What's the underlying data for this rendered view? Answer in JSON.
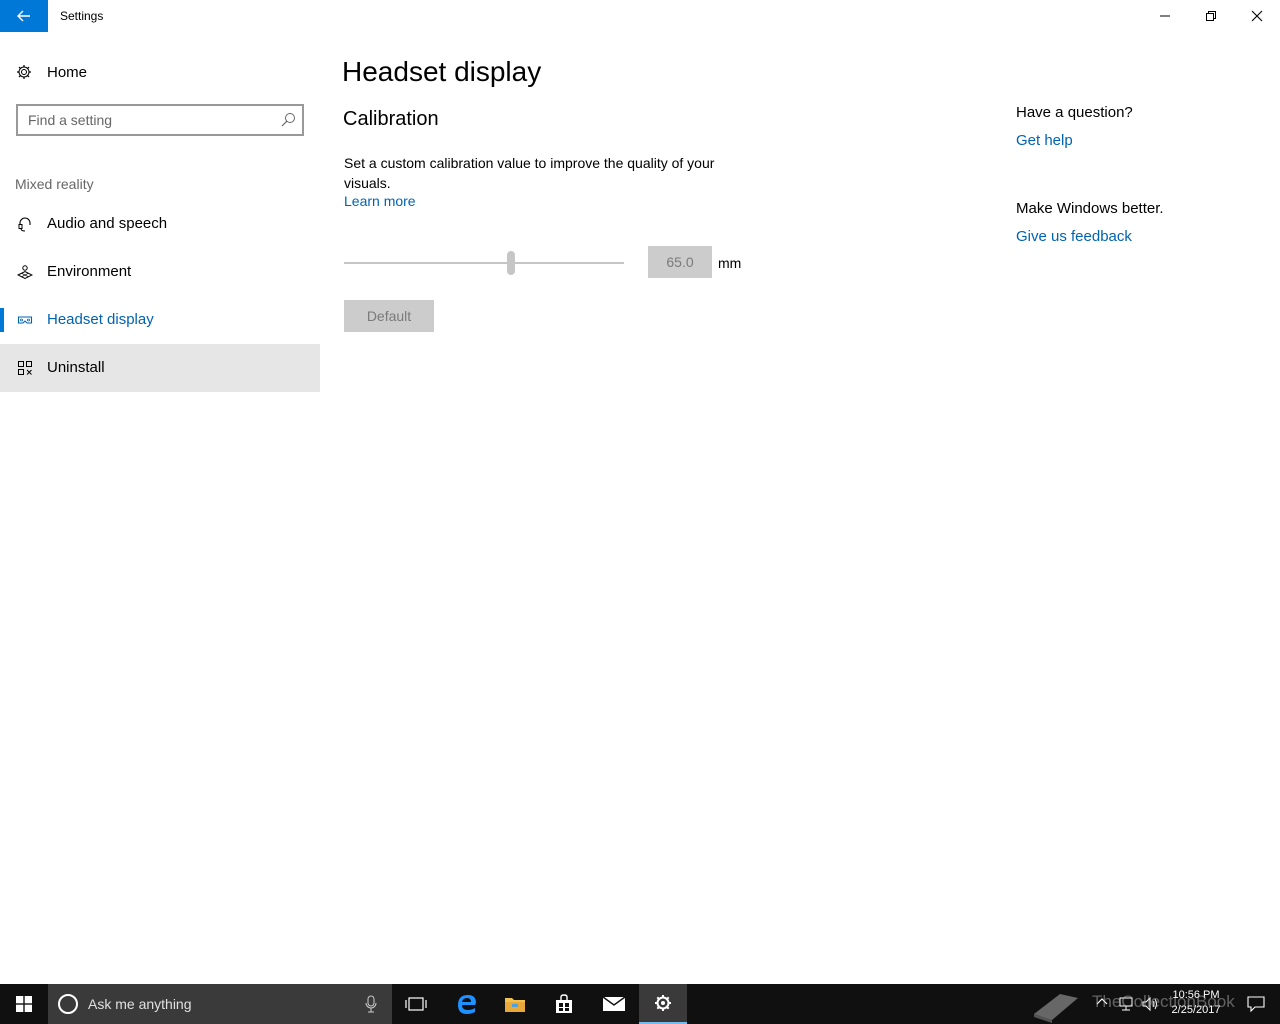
{
  "titlebar": {
    "title": "Settings"
  },
  "sidebar": {
    "home_label": "Home",
    "search_placeholder": "Find a setting",
    "group_label": "Mixed reality",
    "items": [
      {
        "label": "Audio and speech",
        "icon": "headset-icon"
      },
      {
        "label": "Environment",
        "icon": "environment-icon"
      },
      {
        "label": "Headset display",
        "icon": "headset-display-icon",
        "active": true
      },
      {
        "label": "Uninstall",
        "icon": "uninstall-icon",
        "hover": true
      }
    ]
  },
  "main": {
    "page_title": "Headset display",
    "section_title": "Calibration",
    "description": "Set a custom calibration value to improve the quality of your visuals.",
    "learn_more": "Learn more",
    "slider_fraction": 0.6,
    "value": "65.0",
    "unit": "mm",
    "default_button": "Default"
  },
  "help": {
    "question": "Have a question?",
    "get_help": "Get help",
    "better": "Make Windows better.",
    "feedback": "Give us feedback"
  },
  "taskbar": {
    "search_text": "Ask me anything",
    "time": "10:56 PM",
    "date": "2/25/2017",
    "watermark": "TheCollectionBook"
  },
  "colors": {
    "accent": "#0078d7",
    "link": "#0063b1",
    "disabled": "#cccccc"
  }
}
